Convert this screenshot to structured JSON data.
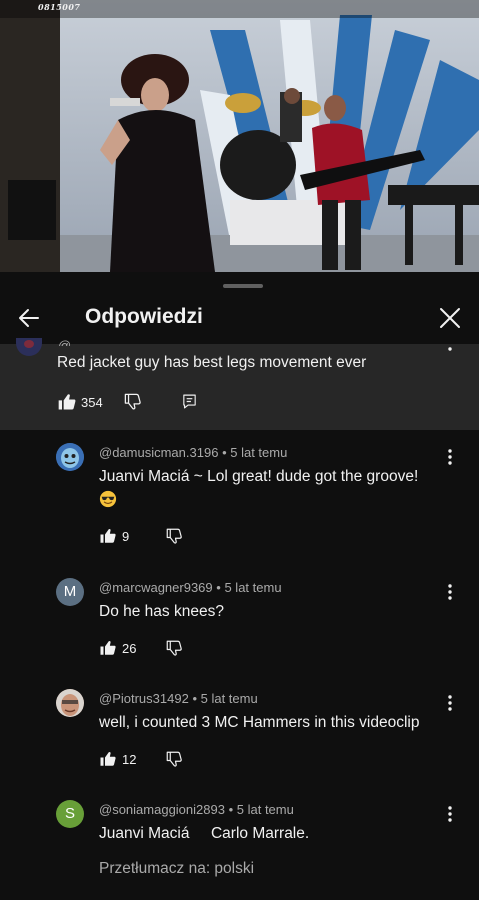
{
  "video": {
    "stamp": "0815007"
  },
  "header": {
    "title": "Odpowiedzi"
  },
  "parent_comment": {
    "meta_stub": "@j",
    "text": "Red jacket guy has best legs movement ever",
    "likes": "354"
  },
  "replies": [
    {
      "author": "@damusicman.3196",
      "time": "5 lat temu",
      "text": "Juanvi Maciá ~ Lol great! dude got the groove!",
      "emoji": "smiling-face-with-sunglasses",
      "likes": "9",
      "avatar_type": "image",
      "avatar_color": "#4a7fbf"
    },
    {
      "author": "@marcwagner9369",
      "time": "5 lat temu",
      "text": "Do he has knees?",
      "likes": "26",
      "avatar_type": "letter",
      "avatar_letter": "M",
      "avatar_color": "#5b6f82"
    },
    {
      "author": "@Piotrus31492",
      "time": "5 lat temu",
      "text": "well, i counted 3 MC Hammers in this videoclip",
      "likes": "12",
      "avatar_type": "image",
      "avatar_color": "#b79a86"
    },
    {
      "author": "@soniamaggioni2893",
      "time": "5 lat temu",
      "text": "Juanvi Maciá     Carlo Marrale.",
      "translate": "Przetłumacz na: polski",
      "avatar_type": "letter",
      "avatar_letter": "S",
      "avatar_color": "#689f38"
    }
  ],
  "separator": "•",
  "colors": {
    "background": "#0f0f0f",
    "parent_background": "#272727",
    "primary_text": "#f1f1f1",
    "secondary_text": "#aaaaaa"
  }
}
